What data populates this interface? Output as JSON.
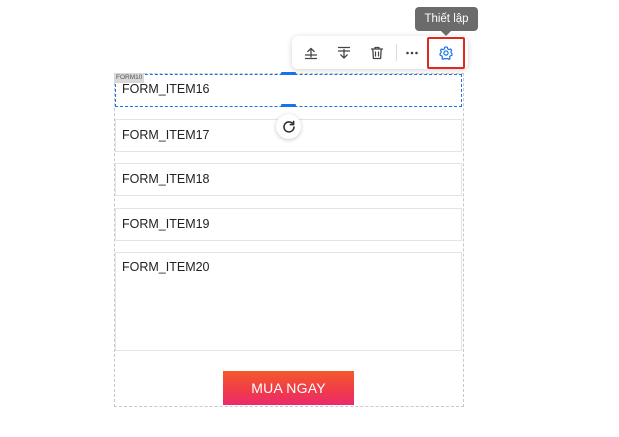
{
  "form": {
    "tag": "FORM10",
    "fields": [
      {
        "label": "FORM_ITEM16"
      },
      {
        "label": "FORM_ITEM17"
      },
      {
        "label": "FORM_ITEM18"
      },
      {
        "label": "FORM_ITEM19"
      },
      {
        "label": "FORM_ITEM20"
      }
    ],
    "submit_label": "MUA NGAY"
  },
  "toolbar": {
    "tooltip": "Thiết lập",
    "icons": [
      "move-up-icon",
      "move-down-icon",
      "delete-icon",
      "more-icon",
      "settings-icon"
    ],
    "accent_color": "#1c73e8",
    "highlight_color": "#e0281e"
  }
}
